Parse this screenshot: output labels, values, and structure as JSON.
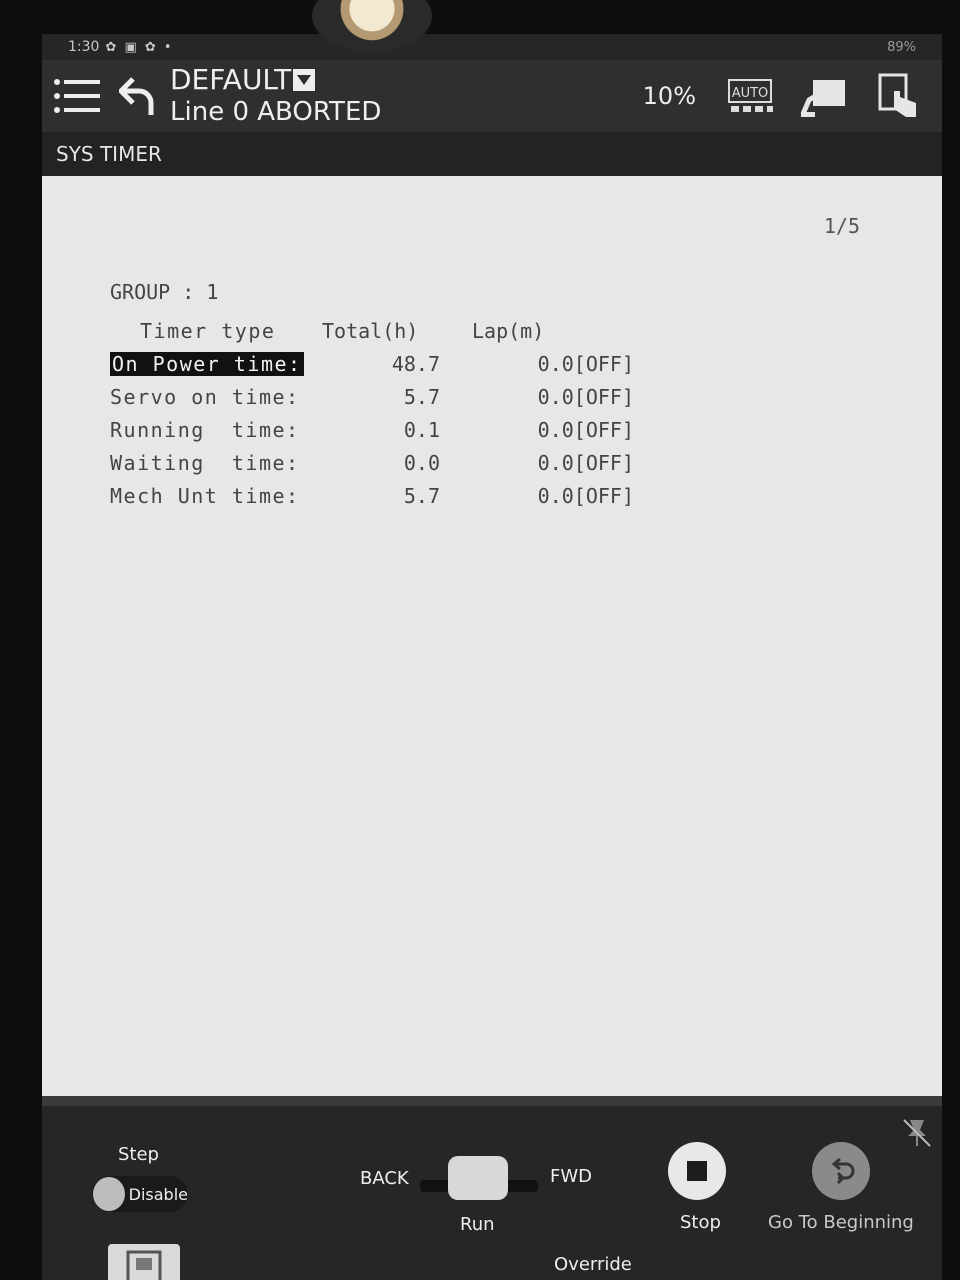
{
  "status_bar": {
    "time": "1:30",
    "battery": "89%"
  },
  "header": {
    "program_name": "DEFAULT",
    "line_status": "Line 0 ABORTED",
    "override_percent": "10%",
    "icons": [
      "menu-icon",
      "back-arrow-icon",
      "dropdown-icon",
      "auto-mode-icon",
      "robot-display-icon",
      "touch-hand-icon"
    ]
  },
  "menu_title": "SYS TIMER",
  "content": {
    "page": "1/5",
    "group_line": "GROUP : 1",
    "columns": {
      "type": "Timer type",
      "total": "Total(h)",
      "lap": "Lap(m)"
    },
    "rows": [
      {
        "type": "On Power time:",
        "total": "48.7",
        "lap": "0.0[OFF]",
        "selected": true
      },
      {
        "type": "Servo on time:",
        "total": "5.7",
        "lap": "0.0[OFF]",
        "selected": false
      },
      {
        "type": "Running  time:",
        "total": "0.1",
        "lap": "0.0[OFF]",
        "selected": false
      },
      {
        "type": "Waiting  time:",
        "total": "0.0",
        "lap": "0.0[OFF]",
        "selected": false
      },
      {
        "type": "Mech Unt time:",
        "total": "5.7",
        "lap": "0.0[OFF]",
        "selected": false
      }
    ]
  },
  "controls": {
    "step_label": "Step",
    "disable_label": "Disable",
    "back_label": "BACK",
    "fwd_label": "FWD",
    "run_label": "Run",
    "stop_label": "Stop",
    "go_to_beginning_label": "Go To Beginning",
    "override_label": "Override"
  }
}
